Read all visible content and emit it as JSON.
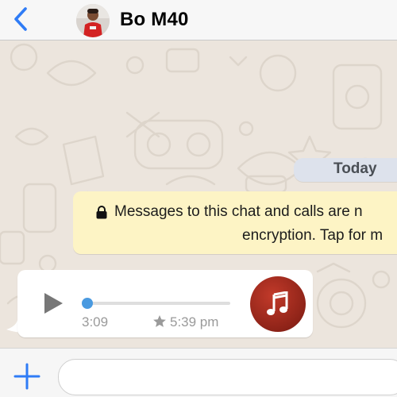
{
  "header": {
    "contact_name": "Bo M40",
    "back_icon": "chevron-left-icon",
    "avatar": "contact-photo"
  },
  "chat": {
    "date_chip": "Today",
    "encryption_notice": {
      "icon": "lock-icon",
      "line1": "Messages to this chat and calls are n",
      "line2": "encryption. Tap for m"
    },
    "voice_message": {
      "duration": "3:09",
      "time": "5:39 pm",
      "starred": true,
      "progress": 0,
      "play_icon": "play-icon",
      "badge_icon": "music-note-icon"
    }
  },
  "composer": {
    "add_icon": "plus-icon",
    "placeholder": ""
  },
  "colors": {
    "accent": "#2f7cf6",
    "chat_bg": "#ece5dd",
    "notice_bg": "#fdf4c5",
    "date_chip_bg": "#dde2ec",
    "music_badge": "#a12c1f"
  }
}
